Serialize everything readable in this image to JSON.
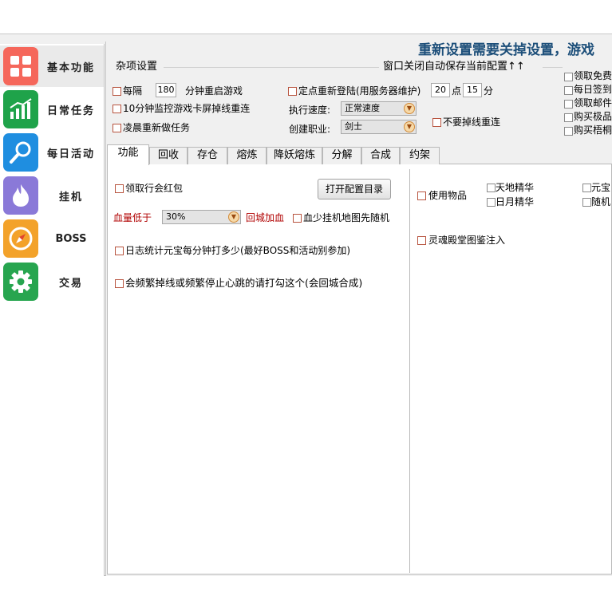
{
  "banner": "重新设置需要关掉设置，游戏",
  "sidebar": {
    "items": [
      {
        "label": "基本功能",
        "icon": "grid-icon",
        "color": "#f5675b"
      },
      {
        "label": "日常任务",
        "icon": "chart-icon",
        "color": "#1fa34a"
      },
      {
        "label": "每日活动",
        "icon": "magnifier-icon",
        "color": "#1f8ee0"
      },
      {
        "label": "挂机",
        "icon": "flame-icon",
        "color": "#8a79d8"
      },
      {
        "label": "BOSS",
        "icon": "compass-icon",
        "color": "#f3a22a"
      },
      {
        "label": "交易",
        "icon": "gear-icon",
        "color": "#27a54f"
      }
    ]
  },
  "misc": {
    "title": "杂项设置",
    "autosave": "窗口关闭自动保存当前配置↑↑",
    "every_label": "每隔",
    "every_minutes": "180",
    "restart_label": "分钟重启游戏",
    "monitor_label": "10分钟监控游戏卡屏掉线重连",
    "dawn_label": "凌晨重新做任务",
    "fixed_login_label": "定点重新登陆(用服务器维护)",
    "login_hour": "20",
    "hour_label": "点",
    "login_minute": "15",
    "minute_label": "分",
    "speed_label": "执行速度:",
    "speed_value": "正常速度",
    "job_label": "创建职业:",
    "job_value": "剑士",
    "no_reconnect_label": "不要掉线重连"
  },
  "right_options": [
    "领取免费",
    "每日签到",
    "领取邮件",
    "购买极品",
    "购买梧桐"
  ],
  "tabs": [
    "功能",
    "回收",
    "存仓",
    "熔炼",
    "降妖熔炼",
    "分解",
    "合成",
    "约架"
  ],
  "function_tab": {
    "guild_redpacket": "领取行会红包",
    "open_config_button": "打开配置目录",
    "hp_low_label": "血量低于",
    "hp_value": "30%",
    "return_city_label": "回城加血",
    "low_hp_random_label": "血少挂机地图先随机",
    "log_stat_label": "日志统计元宝每分钟打多少(最好BOSS和活动别参加)",
    "frequent_disconnect_label": "会频繁掉线或频繁停止心跳的请打勾这个(会回城合成)",
    "use_items_label": "使用物品",
    "items": [
      "天地精华",
      "日月精华",
      "元宝",
      "随机"
    ],
    "soul_label": "灵魂殿堂图鉴注入"
  }
}
